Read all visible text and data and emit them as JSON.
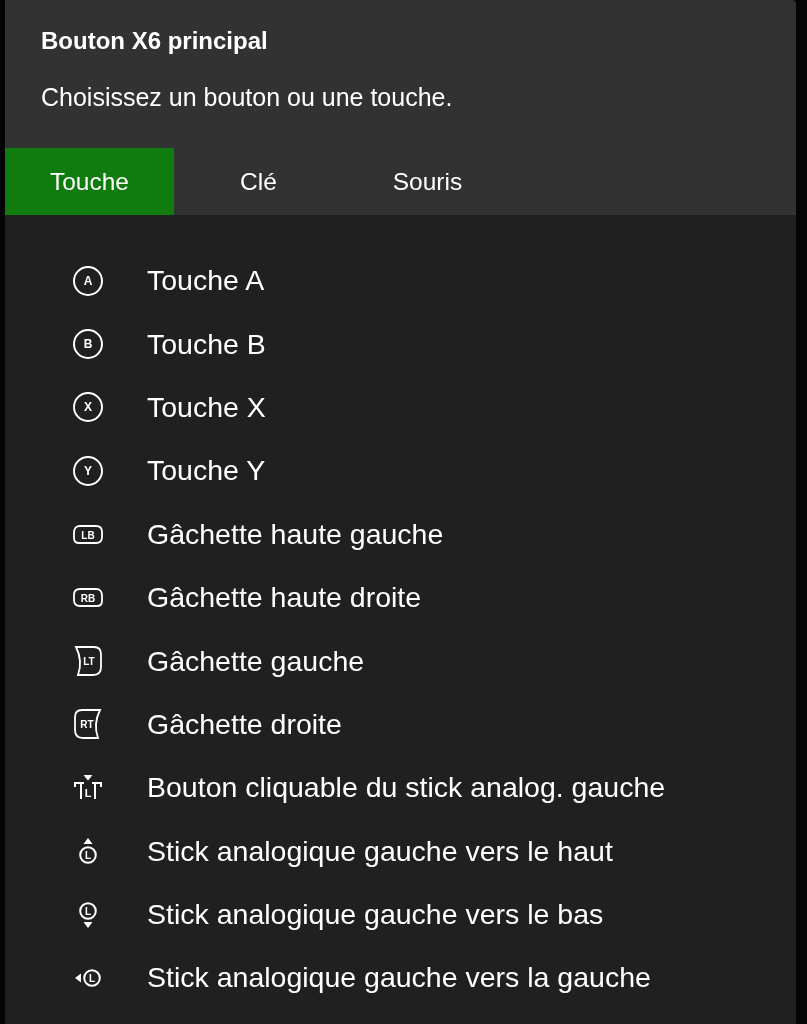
{
  "dialog": {
    "title": "Bouton X6 principal",
    "subtitle": "Choisissez un bouton ou une touche."
  },
  "tabs": [
    {
      "label": "Touche",
      "selected": true
    },
    {
      "label": "Clé",
      "selected": false
    },
    {
      "label": "Souris",
      "selected": false
    }
  ],
  "items": [
    {
      "kind": "face",
      "glyph": "A",
      "label": "Touche A"
    },
    {
      "kind": "face",
      "glyph": "B",
      "label": "Touche B"
    },
    {
      "kind": "face",
      "glyph": "X",
      "label": "Touche X"
    },
    {
      "kind": "face",
      "glyph": "Y",
      "label": "Touche Y"
    },
    {
      "kind": "bumper",
      "mirrored": false,
      "glyph": "LB",
      "label": "Gâchette haute gauche"
    },
    {
      "kind": "bumper",
      "mirrored": true,
      "glyph": "RB",
      "label": "Gâchette haute droite"
    },
    {
      "kind": "trigger",
      "mirrored": false,
      "glyph": "LT",
      "label": "Gâchette gauche"
    },
    {
      "kind": "trigger",
      "mirrored": true,
      "glyph": "RT",
      "label": "Gâchette droite"
    },
    {
      "kind": "stickclick",
      "glyph": "L",
      "label": "Bouton cliquable du stick analog. gauche"
    },
    {
      "kind": "stickup",
      "glyph": "L",
      "label": "Stick analogique gauche vers le haut"
    },
    {
      "kind": "stickdown",
      "glyph": "L",
      "label": "Stick analogique gauche vers le bas"
    },
    {
      "kind": "stickleft",
      "glyph": "L",
      "label": "Stick analogique gauche vers la gauche"
    }
  ]
}
